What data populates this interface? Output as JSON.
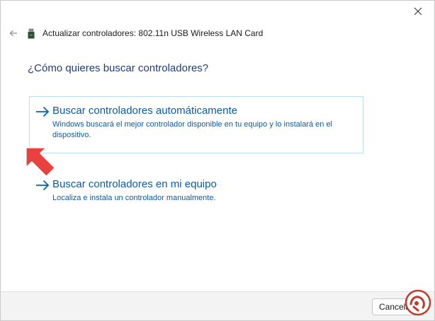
{
  "window": {
    "title": "Actualizar controladores: 802.11n USB Wireless LAN Card"
  },
  "heading": "¿Cómo quieres buscar controladores?",
  "options": [
    {
      "title": "Buscar controladores automáticamente",
      "description": "Windows buscará el mejor controlador disponible en tu equipo y lo instalará en el dispositivo."
    },
    {
      "title": "Buscar controladores en mi equipo",
      "description": "Localiza e instala un controlador manualmente."
    }
  ],
  "footer": {
    "cancel_label": "Cancelar"
  },
  "icons": {
    "back": "back-arrow-icon",
    "device": "usb-device-icon",
    "close": "close-icon",
    "option_arrow": "right-arrow-icon",
    "annotation": "red-pointer-arrow-icon",
    "watermark": "solvetic-logo-icon"
  },
  "colors": {
    "link_blue": "#0a5aa8",
    "heading_blue": "#1f3d7a",
    "selected_border": "#b8dff2",
    "annotation_red": "#e8413e",
    "footer_bg": "#f3f3f3"
  }
}
